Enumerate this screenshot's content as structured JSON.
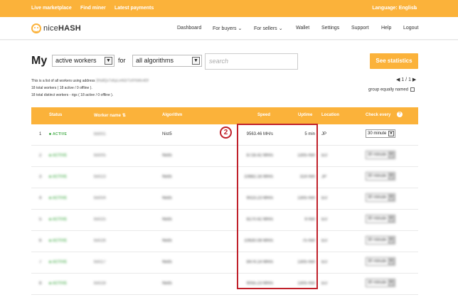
{
  "topbar": {
    "links": [
      "Live marketplace",
      "Find miner",
      "Latest payments"
    ],
    "language": "Language: English"
  },
  "navbar": {
    "logo_text_a": "nice",
    "logo_text_b": "HASH",
    "items": [
      "Dashboard",
      "For buyers",
      "For sellers",
      "Wallet",
      "Settings",
      "Support",
      "Help",
      "Logout"
    ]
  },
  "controls": {
    "my_label": "My",
    "worker_filter": "active workers",
    "for_label": "for",
    "algorithm_filter": "all algorithms",
    "search_placeholder": "search",
    "stats_button": "See statistics"
  },
  "info": {
    "line1": "This is a list of all workers using address",
    "address": "3Hs8Qv7xKpLmN2rTz9YbWc4Df",
    "line2": "18 total workers ( 18 active / 0 offline ).",
    "line3": "18 total distinct workers - rigs ( 18 active / 0 offline )."
  },
  "pager": {
    "text": "1 / 1"
  },
  "group_label": "group equally named",
  "table": {
    "headers": {
      "status": "Status",
      "worker": "Worker name",
      "algorithm": "Algorithm",
      "speed": "Speed",
      "uptime": "Uptime",
      "location": "Location",
      "check": "Check every"
    },
    "rows": [
      {
        "num": "1",
        "status": "ACTIVE",
        "worker": "bo001",
        "algo": "Nist5",
        "speed": "9563.46 MH/s",
        "uptime": "5 min",
        "loc": "JP",
        "check": "30 minute"
      },
      {
        "num": "2",
        "status": "ACTIVE",
        "worker": "bo005",
        "algo": "Nist5",
        "speed": "8716.42 MH/s",
        "uptime": "1305 min",
        "loc": "EU",
        "check": "30 minute"
      },
      {
        "num": "3",
        "status": "ACTIVE",
        "worker": "bo023",
        "algo": "Nist5",
        "speed": "10682.16 MH/s",
        "uptime": "314 min",
        "loc": "JP",
        "check": "30 minute"
      },
      {
        "num": "4",
        "status": "ACTIVE",
        "worker": "bo004",
        "algo": "Nist5",
        "speed": "9023.23 MH/s",
        "uptime": "1305 min",
        "loc": "EU",
        "check": "30 minute"
      },
      {
        "num": "5",
        "status": "ACTIVE",
        "worker": "bo025",
        "algo": "Nist5",
        "speed": "8270.42 MH/s",
        "uptime": "9 min",
        "loc": "EU",
        "check": "30 minute"
      },
      {
        "num": "6",
        "status": "ACTIVE",
        "worker": "bo026",
        "algo": "Nist5",
        "speed": "10630.08 MH/s",
        "uptime": "75 min",
        "loc": "EU",
        "check": "30 minute"
      },
      {
        "num": "7",
        "status": "ACTIVE",
        "worker": "bo027",
        "algo": "Nist5",
        "speed": "8474.14 MH/s",
        "uptime": "1305 min",
        "loc": "EU",
        "check": "30 minute"
      },
      {
        "num": "8",
        "status": "ACTIVE",
        "worker": "bo028",
        "algo": "Nist5",
        "speed": "9055.23 MH/s",
        "uptime": "1305 min",
        "loc": "EU",
        "check": "30 minute"
      }
    ]
  },
  "callout": {
    "number": "2"
  },
  "colors": {
    "accent": "#fbb23a",
    "active": "#4caf50",
    "callout": "#c0202a"
  }
}
